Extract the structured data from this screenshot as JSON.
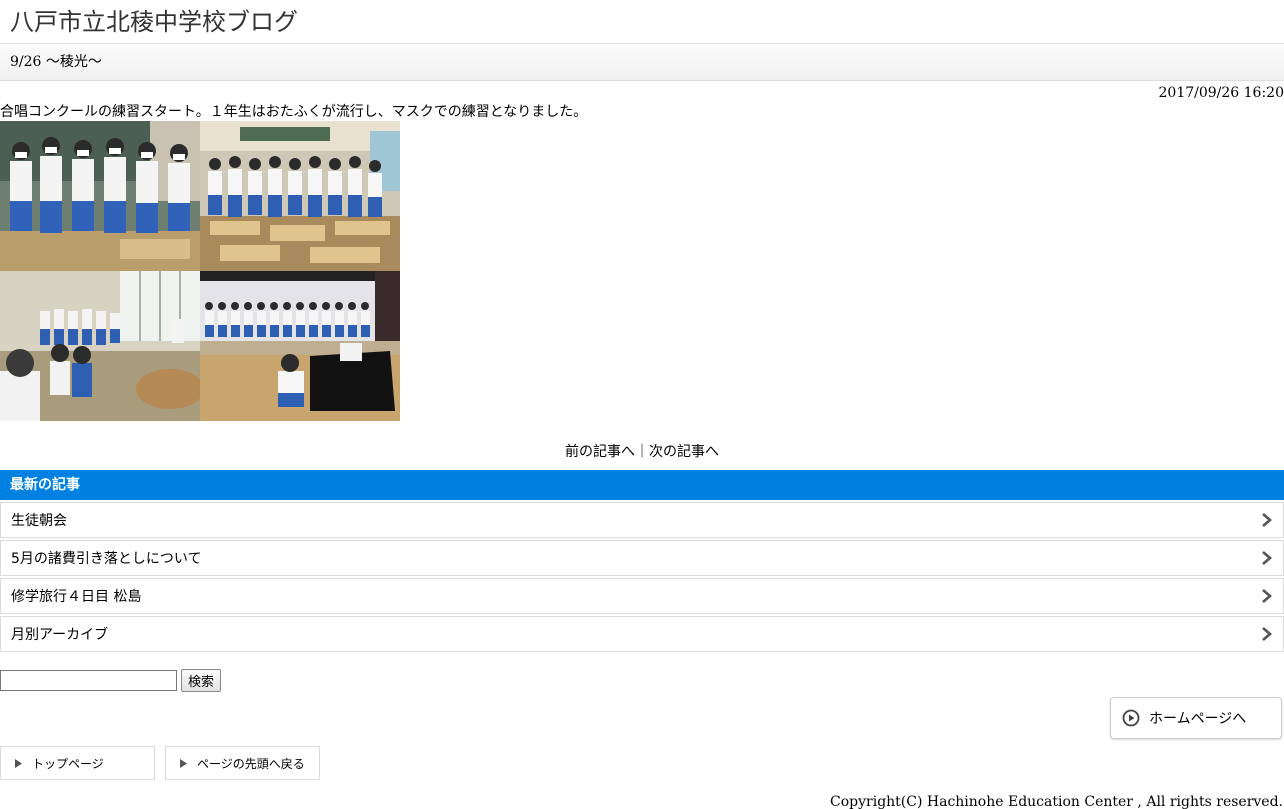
{
  "site": {
    "title": "八戸市立北稜中学校ブログ"
  },
  "entry": {
    "title": "9/26 ～稜光～",
    "date": "2017/09/26 16:20",
    "body": "合唱コンクールの練習スタート。１年生はおたふくが流行し、マスクでの練習となりました。"
  },
  "pager": {
    "prev": "前の記事へ",
    "separator": "｜",
    "next": "次の記事へ"
  },
  "recent": {
    "heading": "最新の記事",
    "items": [
      {
        "label": "生徒朝会"
      },
      {
        "label": "5月の諸費引き落としについて"
      },
      {
        "label": "修学旅行４日目 松島"
      },
      {
        "label": "月別アーカイブ"
      }
    ]
  },
  "search": {
    "value": "",
    "button_label": "検索"
  },
  "home_link": {
    "label": "ホームページへ"
  },
  "footer_nav": {
    "top_page": "トップページ",
    "back_to_top": "ページの先頭へ戻る"
  },
  "copyright": "Copyright(C) Hachinohe Education Center , All rights reserved.",
  "colors": {
    "accent": "#0080e0",
    "border": "#dcdcdc",
    "chevron": "#555555"
  },
  "icons": {
    "recent_chevron": "chevron-right-icon",
    "home": "play-circle-icon",
    "footer": "triangle-right-icon"
  }
}
